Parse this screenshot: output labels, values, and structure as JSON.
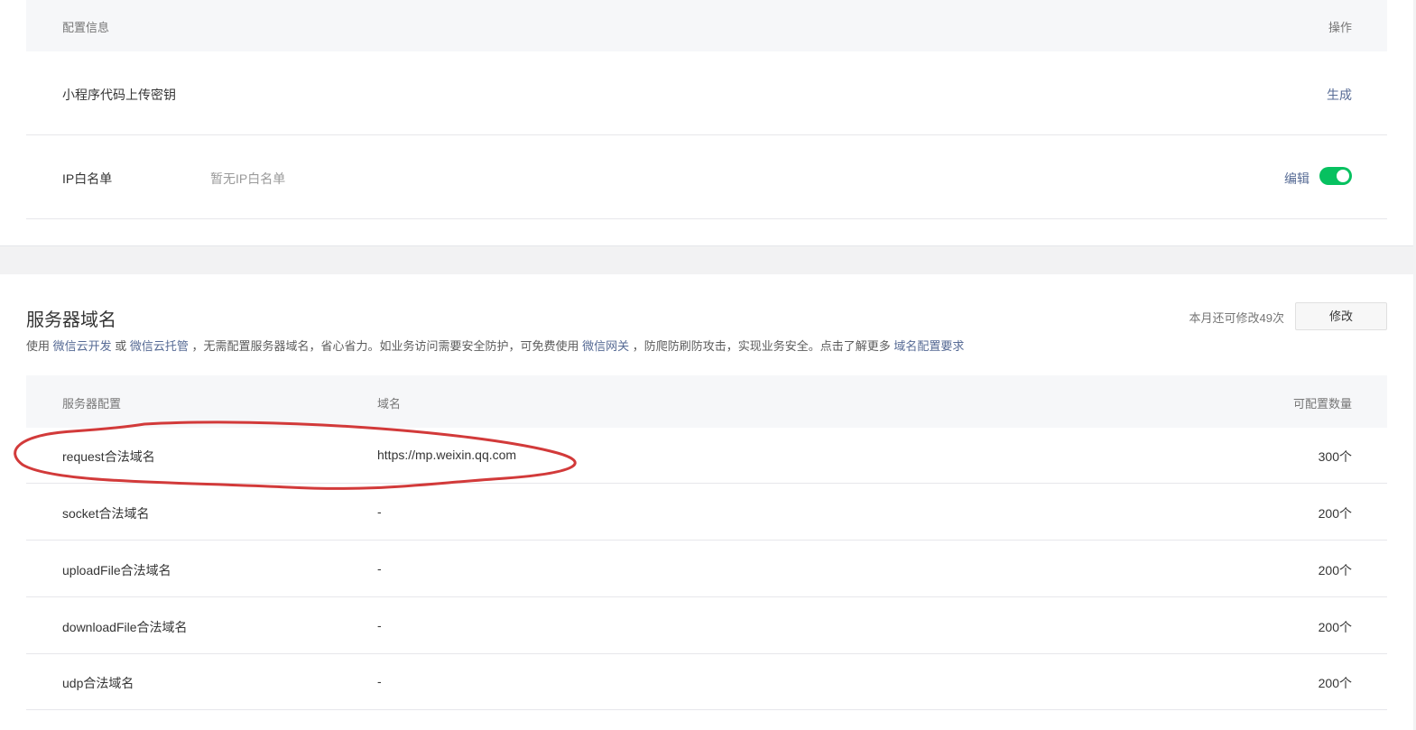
{
  "config_table": {
    "header": {
      "info": "配置信息",
      "action": "操作"
    },
    "rows": [
      {
        "name": "小程序代码上传密钥",
        "value": "",
        "action": "生成"
      },
      {
        "name": "IP白名单",
        "value": "暂无IP白名单",
        "action": "编辑",
        "toggle_on": true
      }
    ]
  },
  "server_domain": {
    "title": "服务器域名",
    "quota_text": "本月还可修改49次",
    "modify_label": "修改",
    "description": {
      "p1": "使用 ",
      "link1": "微信云开发",
      "p2": " 或 ",
      "link2": "微信云托管",
      "p3": " ，无需配置服务器域名，省心省力。如业务访问需要安全防护，可免费使用 ",
      "link3": "微信网关",
      "p4": " ，防爬防刷防攻击，实现业务安全。点击了解更多 ",
      "link4": "域名配置要求"
    },
    "header": {
      "config": "服务器配置",
      "domain": "域名",
      "count": "可配置数量"
    },
    "rows": [
      {
        "config": "request合法域名",
        "domain": "https://mp.weixin.qq.com",
        "count": "300个"
      },
      {
        "config": "socket合法域名",
        "domain": "-",
        "count": "200个"
      },
      {
        "config": "uploadFile合法域名",
        "domain": "-",
        "count": "200个"
      },
      {
        "config": "downloadFile合法域名",
        "domain": "-",
        "count": "200个"
      },
      {
        "config": "udp合法域名",
        "domain": "-",
        "count": "200个"
      }
    ]
  },
  "colors": {
    "toggle": "#07c160",
    "link": "#576b95",
    "annotation": "#d23a3a"
  }
}
